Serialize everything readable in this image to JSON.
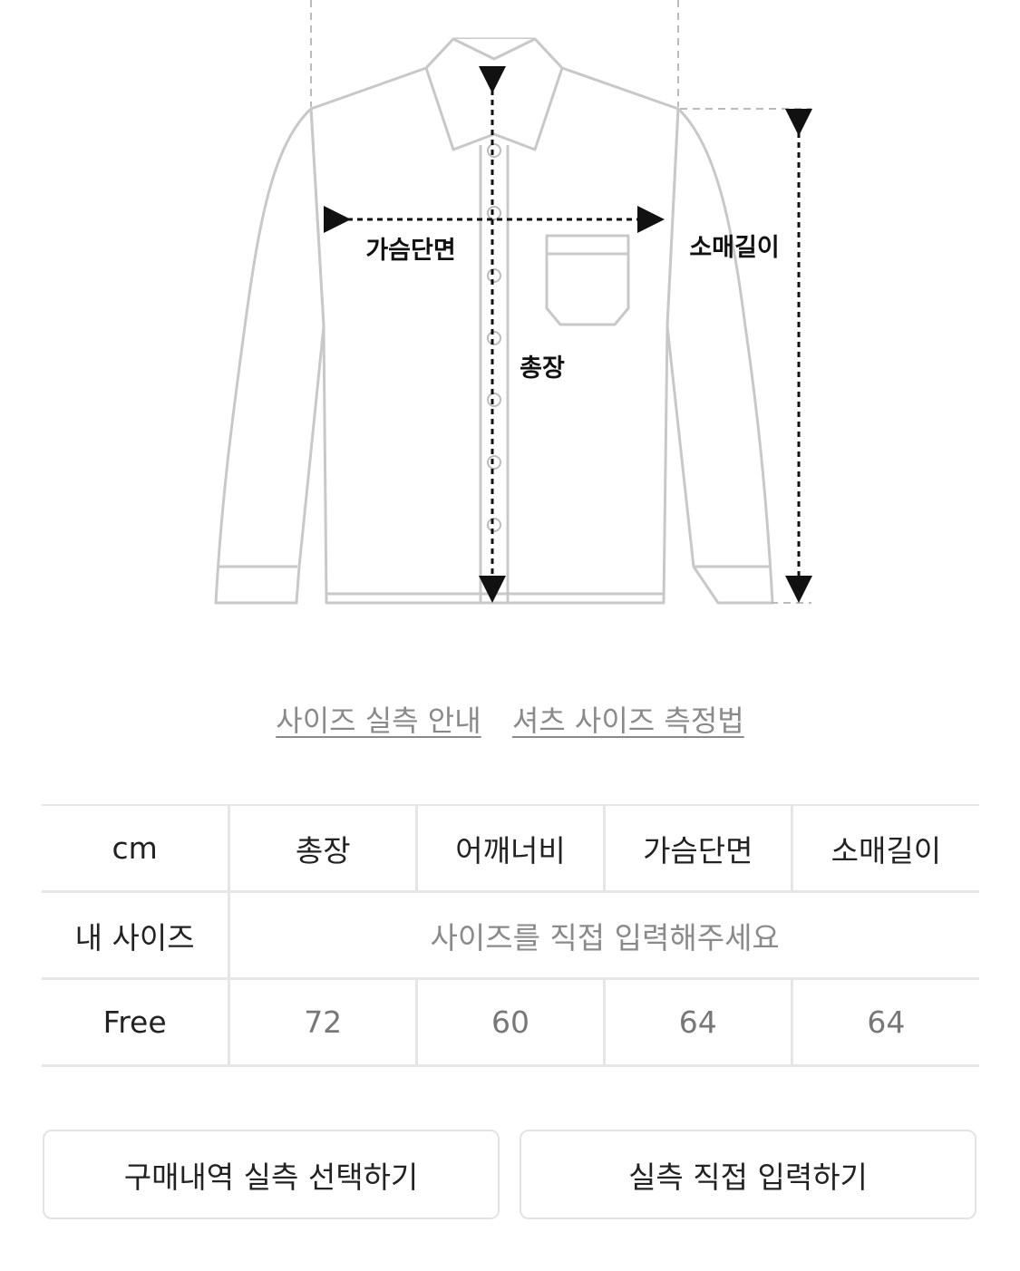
{
  "diagram": {
    "label_chest": "가슴단면",
    "label_sleeve": "소매길이",
    "label_length": "총장"
  },
  "links": {
    "size_guide": "사이즈 실측 안내",
    "shirt_measure": "셔츠 사이즈 측정법"
  },
  "table": {
    "unit": "cm",
    "columns": [
      "총장",
      "어깨너비",
      "가슴단면",
      "소매길이"
    ],
    "my_size_label": "내 사이즈",
    "my_size_placeholder": "사이즈를 직접 입력해주세요",
    "rows": [
      {
        "size": "Free",
        "values": [
          "72",
          "60",
          "64",
          "64"
        ]
      }
    ]
  },
  "buttons": {
    "purchase_history": "구매내역 실측 선택하기",
    "direct_input": "실측 직접 입력하기"
  }
}
